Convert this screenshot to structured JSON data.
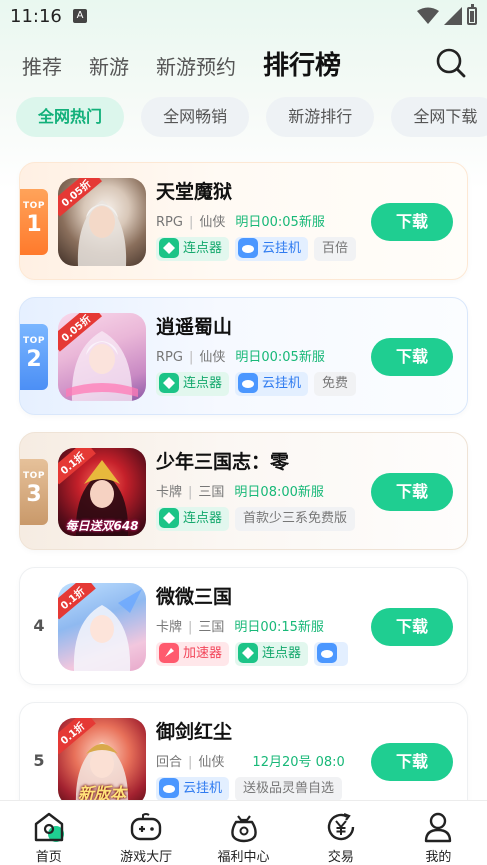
{
  "status_bar": {
    "time": "11:16",
    "notification_letter": "A"
  },
  "top_tabs": [
    {
      "label": "推荐",
      "active": false
    },
    {
      "label": "新游",
      "active": false
    },
    {
      "label": "新游预约",
      "active": false
    },
    {
      "label": "排行榜",
      "active": true
    }
  ],
  "chips": [
    {
      "label": "全网热门",
      "active": true
    },
    {
      "label": "全网畅销",
      "active": false
    },
    {
      "label": "新游排行",
      "active": false
    },
    {
      "label": "全网下载",
      "active": false
    }
  ],
  "rank_flag_text": "TOP",
  "games": [
    {
      "rank": "1",
      "name": "天堂魔狱",
      "category": "RPG",
      "genre": "仙侠",
      "launch": "明日00:05新服",
      "discount": "0.05折",
      "caption": "",
      "tags": [
        {
          "label": "连点器",
          "type": "green"
        },
        {
          "label": "云挂机",
          "type": "blue"
        },
        {
          "label": "百倍",
          "type": "gray"
        }
      ],
      "button": "下载"
    },
    {
      "rank": "2",
      "name": "逍遥蜀山",
      "category": "RPG",
      "genre": "仙侠",
      "launch": "明日00:05新服",
      "discount": "0.05折",
      "caption": "",
      "tags": [
        {
          "label": "连点器",
          "type": "green"
        },
        {
          "label": "云挂机",
          "type": "blue"
        },
        {
          "label": "免费",
          "type": "gray"
        }
      ],
      "button": "下载"
    },
    {
      "rank": "3",
      "name": "少年三国志：零",
      "category": "卡牌",
      "genre": "三国",
      "launch": "明日08:00新服",
      "discount": "0.1折",
      "caption": "每日送双648",
      "tags": [
        {
          "label": "连点器",
          "type": "green"
        },
        {
          "label": "首款少三系免费版",
          "type": "gray"
        }
      ],
      "button": "下载"
    },
    {
      "rank": "4",
      "name": "微微三国",
      "category": "卡牌",
      "genre": "三国",
      "launch": "明日00:15新服",
      "discount": "0.1折",
      "caption": "",
      "tags": [
        {
          "label": "加速器",
          "type": "red"
        },
        {
          "label": "连点器",
          "type": "green"
        },
        {
          "label": "",
          "type": "blue"
        }
      ],
      "button": "下载"
    },
    {
      "rank": "5",
      "name": "御剑红尘",
      "category": "回合",
      "genre": "仙侠",
      "launch": "12月20号 08:0",
      "discount": "0.1折",
      "caption": "新版本",
      "tags": [
        {
          "label": "云挂机",
          "type": "blue"
        },
        {
          "label": "送极品灵兽自选",
          "type": "gray"
        }
      ],
      "button": "下载"
    }
  ],
  "bottom_nav": [
    {
      "label": "首页",
      "icon": "home-icon",
      "active": true
    },
    {
      "label": "游戏大厅",
      "icon": "gamepad-icon",
      "active": false
    },
    {
      "label": "福利中心",
      "icon": "gift-bag-icon",
      "active": false
    },
    {
      "label": "交易",
      "icon": "yuan-exchange-icon",
      "active": false
    },
    {
      "label": "我的",
      "icon": "user-icon",
      "active": false
    }
  ],
  "colors": {
    "accent": "#1fce91",
    "accent_text": "#12b07a",
    "launch_text": "#18b878"
  }
}
